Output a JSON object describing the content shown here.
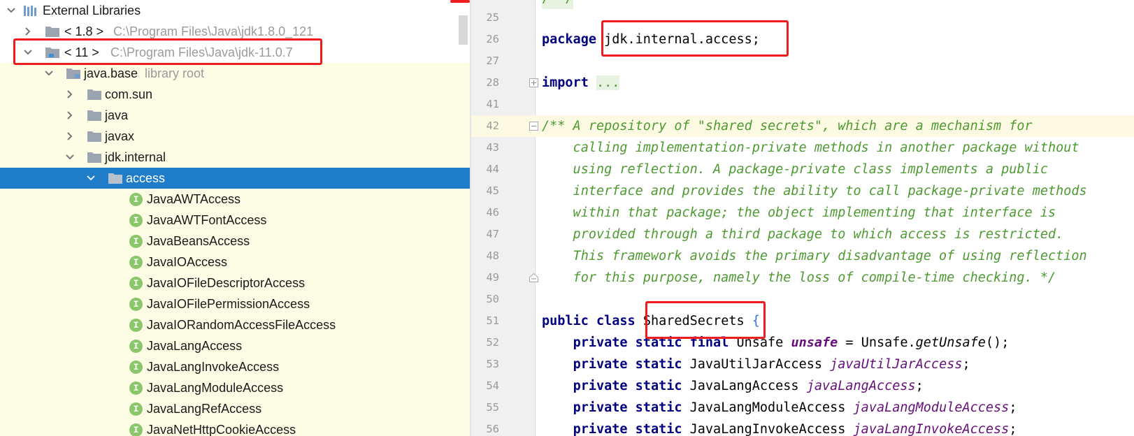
{
  "project_tree": {
    "root_label": "External Libraries",
    "rows": [
      {
        "label": "< 1.8 >",
        "path": "C:\\Program Files\\Java\\jdk1.8.0_121"
      },
      {
        "label": "< 11 >",
        "path": "C:\\Program Files\\Java\\jdk-11.0.7"
      },
      {
        "label": "java.base",
        "note": "library root"
      },
      {
        "label": "com.sun"
      },
      {
        "label": "java"
      },
      {
        "label": "javax"
      },
      {
        "label": "jdk.internal"
      },
      {
        "label": "access"
      }
    ],
    "interface_badge": "I",
    "interfaces": [
      "JavaAWTAccess",
      "JavaAWTFontAccess",
      "JavaBeansAccess",
      "JavaIOAccess",
      "JavaIOFileDescriptorAccess",
      "JavaIOFilePermissionAccess",
      "JavaIORandomAccessFileAccess",
      "JavaLangAccess",
      "JavaLangInvokeAccess",
      "JavaLangModuleAccess",
      "JavaLangRefAccess",
      "JavaNetHttpCookieAccess"
    ]
  },
  "editor": {
    "line_numbers": [
      "25",
      "26",
      "27",
      "28",
      "41",
      "42",
      "43",
      "44",
      "45",
      "46",
      "47",
      "48",
      "49",
      "50",
      "51",
      "52",
      "53",
      "54",
      "55",
      "56"
    ],
    "top_fragment": "/**/",
    "package_kw": "package",
    "package_name": "jdk.internal.access;",
    "import_kw": "import",
    "import_fold": "...",
    "doc_comment": [
      "/** A repository of \"shared secrets\", which are a mechanism for",
      "    calling implementation-private methods in another package without",
      "    using reflection. A package-private class implements a public",
      "    interface and provides the ability to call package-private methods",
      "    within that package; the object implementing that interface is",
      "    provided through a third package to which access is restricted.",
      "    This framework avoids the primary disadvantage of using reflection",
      "    for this purpose, namely the loss of compile-time checking. */"
    ],
    "kw_public": "public",
    "kw_class": "class",
    "class_name": "SharedSecrets",
    "open_brace": "{",
    "kw_private": "private",
    "kw_static": "static",
    "kw_final": "final",
    "f1_type": "Unsafe",
    "f1_name": "unsafe",
    "f1_eq": " = Unsafe.",
    "f1_call": "getUnsafe",
    "f1_end": "();",
    "fields": [
      {
        "type": "JavaUtilJarAccess",
        "name": "javaUtilJarAccess"
      },
      {
        "type": "JavaLangAccess",
        "name": "javaLangAccess"
      },
      {
        "type": "JavaLangModuleAccess",
        "name": "javaLangModuleAccess"
      },
      {
        "type": "JavaLangInvokeAccess",
        "name": "javaLangInvokeAccess"
      }
    ],
    "semicolon": ";"
  },
  "colors": {
    "selection": "#1f7cc9",
    "highlight_row": "#fdfde6",
    "keyword": "#000080",
    "comment": "#4d9a31",
    "field": "#660e7a",
    "annotation_box": "#ee1c1c",
    "interface_icon": "#8ac66a"
  }
}
